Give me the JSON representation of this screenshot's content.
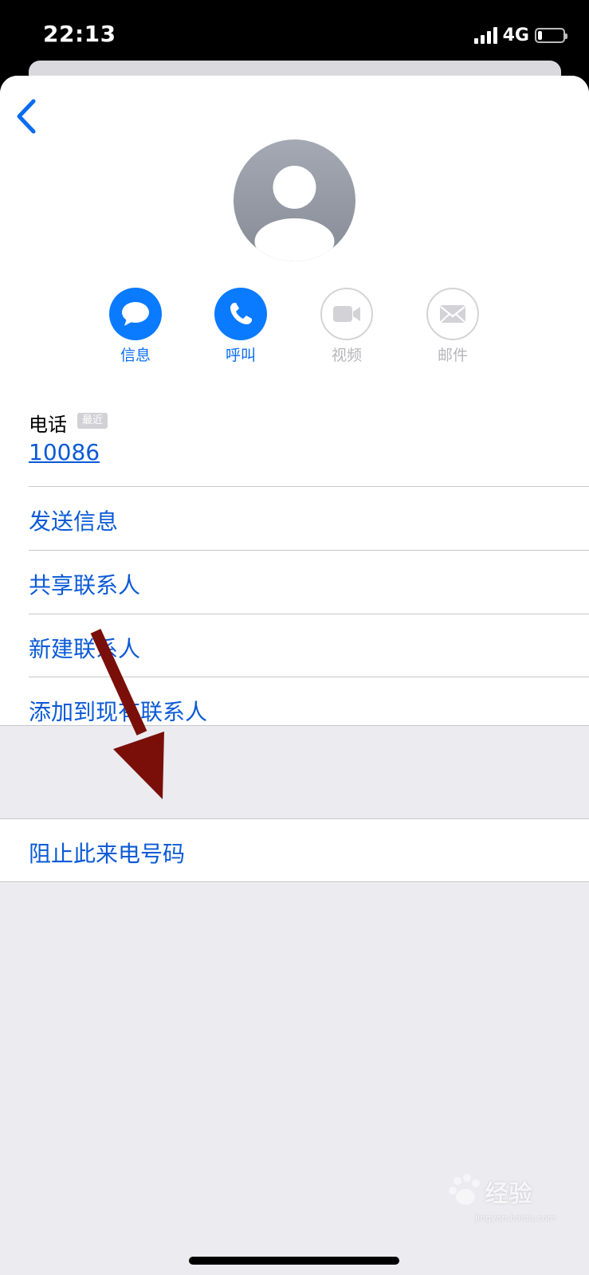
{
  "status_bar": {
    "time": "22:13",
    "network": "4G",
    "battery_level": 0.15
  },
  "contact": {
    "avatar_icon": "person-silhouette-icon"
  },
  "actions": [
    {
      "label": "信息",
      "icon": "message-bubble-icon",
      "enabled": true
    },
    {
      "label": "呼叫",
      "icon": "phone-icon",
      "enabled": true
    },
    {
      "label": "视频",
      "icon": "video-camera-icon",
      "enabled": false
    },
    {
      "label": "邮件",
      "icon": "envelope-icon",
      "enabled": false
    }
  ],
  "phone": {
    "label": "电话",
    "badge": "最近",
    "number": "10086"
  },
  "menu": [
    {
      "label": "发送信息"
    },
    {
      "label": "共享联系人"
    },
    {
      "label": "新建联系人"
    },
    {
      "label": "添加到现有联系人"
    }
  ],
  "block": {
    "label": "阻止此来电号码"
  },
  "watermark": {
    "text": "经验",
    "sub": "jingyan.baidu.com"
  },
  "colors": {
    "accent": "#0a7aff",
    "link": "#0a5ad6",
    "arrow": "#7a0f0a"
  }
}
